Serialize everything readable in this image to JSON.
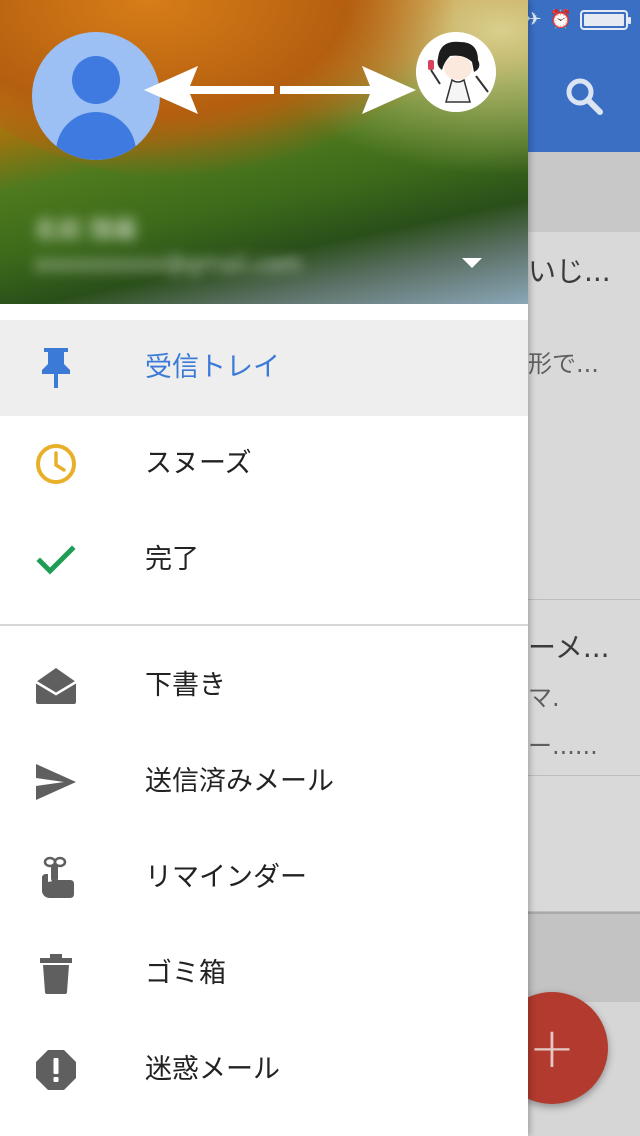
{
  "colors": {
    "accent_blue": "#3c7ad8",
    "snooze_yellow": "#e8b02a",
    "done_green": "#1f9d55",
    "icon_gray": "#5f5f5f",
    "fab_red": "#b33a2e"
  },
  "background": {
    "status_icons": [
      "bluetooth-icon",
      "alarm-icon",
      "battery-icon"
    ],
    "snippets": [
      "いじ...",
      "形で...",
      "ーメ...",
      "マ.",
      "ー......"
    ],
    "fab_label": "+"
  },
  "drawer": {
    "account": {
      "name": "名前 隠蔽",
      "email": "xxxxxxxxxx@gmail.com",
      "primary_avatar_icon": "person-icon",
      "secondary_avatar_icon": "profile-avatar",
      "switch_icon": "double-arrow-icon",
      "dropdown_icon": "caret-down-icon"
    },
    "primary_items": [
      {
        "label": "受信トレイ",
        "icon": "pin-icon",
        "active": true
      },
      {
        "label": "スヌーズ",
        "icon": "clock-icon",
        "active": false
      },
      {
        "label": "完了",
        "icon": "check-icon",
        "active": false
      }
    ],
    "secondary_items": [
      {
        "label": "下書き",
        "icon": "draft-envelope-icon"
      },
      {
        "label": "送信済みメール",
        "icon": "send-icon"
      },
      {
        "label": "リマインダー",
        "icon": "reminder-finger-icon"
      },
      {
        "label": "ゴミ箱",
        "icon": "trash-icon"
      },
      {
        "label": "迷惑メール",
        "icon": "spam-icon"
      }
    ]
  }
}
